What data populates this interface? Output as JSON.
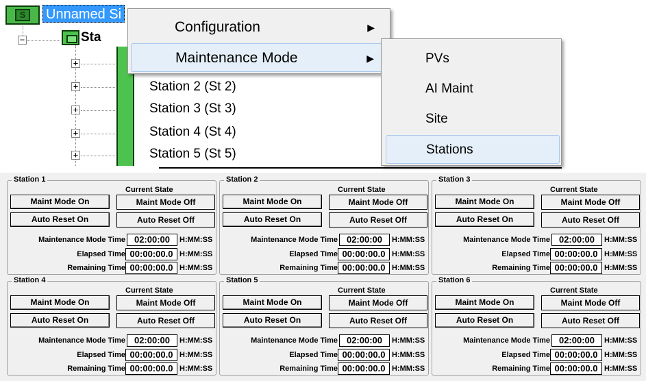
{
  "tree": {
    "site_label": "Unnamed Si",
    "site_icon_letter": "S",
    "root_station_label": "Sta",
    "stations": [
      "Station 2 (St 2)",
      "Station 3 (St 3)",
      "Station 4 (St 4)",
      "Station 5 (St 5)"
    ],
    "expander_plus": "+",
    "expander_minus": "−"
  },
  "context_menu": {
    "items": [
      {
        "label": "Configuration",
        "arrow": "▶"
      },
      {
        "label": "Maintenance Mode",
        "arrow": "▶"
      }
    ],
    "submenu": [
      "PVs",
      "AI Maint",
      "Site",
      "Stations"
    ]
  },
  "panels": {
    "current_state_label": "Current State",
    "maint_on_label": "Maint Mode On",
    "auto_reset_on_label": "Auto Reset On",
    "maint_state": "Maint Mode Off",
    "auto_reset_state": "Auto Reset Off",
    "maint_time_label": "Maintenance Mode Time",
    "elapsed_label": "Elapsed Time",
    "remaining_label": "Remaining Time",
    "unit": "H:MM:SS",
    "stations": [
      {
        "title": "Station 1",
        "maint_time": "02:00:00",
        "elapsed": "00:00:00.0",
        "remaining": "00:00:00.0"
      },
      {
        "title": "Station 2",
        "maint_time": "02:00:00",
        "elapsed": "00:00:00.0",
        "remaining": "00:00:00.0"
      },
      {
        "title": "Station 3",
        "maint_time": "02:00:00",
        "elapsed": "00:00:00.0",
        "remaining": "00:00:00.0"
      },
      {
        "title": "Station 4",
        "maint_time": "02:00:00",
        "elapsed": "00:00:00.0",
        "remaining": "00:00:00.0"
      },
      {
        "title": "Station 5",
        "maint_time": "02:00:00",
        "elapsed": "00:00:00.0",
        "remaining": "00:00:00.0"
      },
      {
        "title": "Station 6",
        "maint_time": "02:00:00",
        "elapsed": "00:00:00.0",
        "remaining": "00:00:00.0"
      }
    ]
  }
}
